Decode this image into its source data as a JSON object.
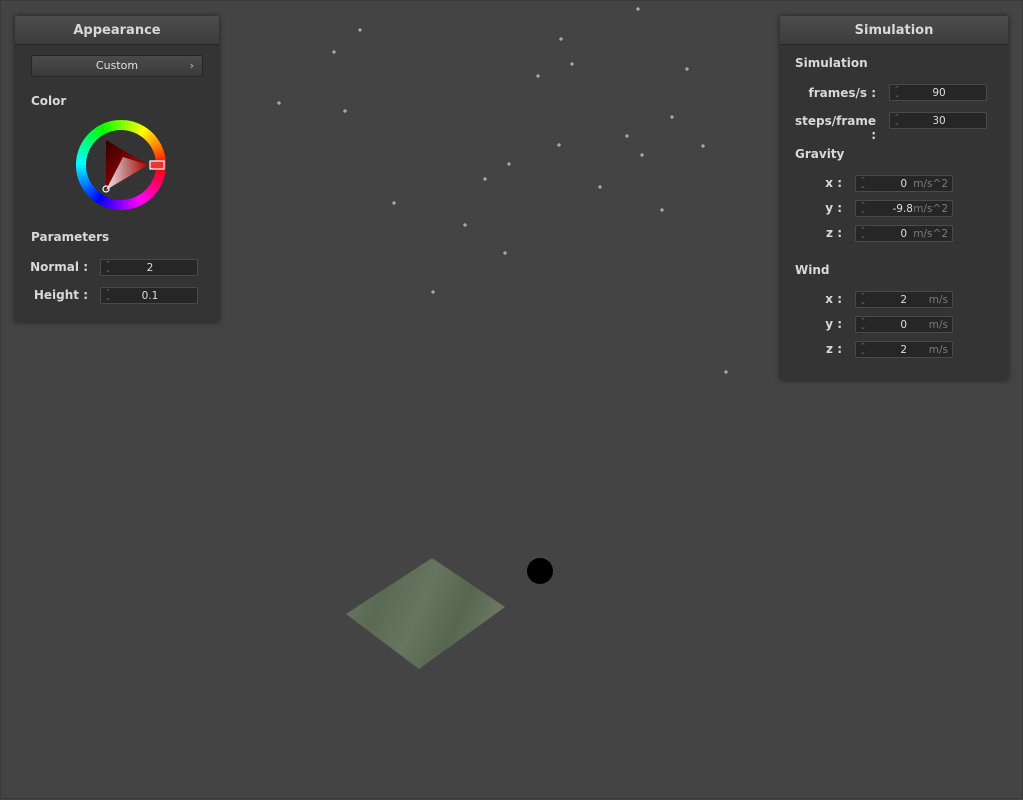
{
  "appearance": {
    "title": "Appearance",
    "preset_button": "Custom",
    "color_label": "Color",
    "selected_color": "#ff0000",
    "parameters_label": "Parameters",
    "normal": {
      "label": "Normal :",
      "value": "2"
    },
    "height": {
      "label": "Height :",
      "value": "0.1"
    }
  },
  "simulation": {
    "title": "Simulation",
    "simulation_section": "Simulation",
    "frames": {
      "label": "frames/s :",
      "value": "90"
    },
    "steps": {
      "label": "steps/frame :",
      "value": "30"
    },
    "gravity_section": "Gravity",
    "gravity": [
      {
        "label": "x :",
        "value": "0",
        "unit": "m/s^2"
      },
      {
        "label": "y :",
        "value": "-9.8",
        "unit": "m/s^2"
      },
      {
        "label": "z :",
        "value": "0",
        "unit": "m/s^2"
      }
    ],
    "wind_section": "Wind",
    "wind": [
      {
        "label": "x :",
        "value": "2",
        "unit": "m/s"
      },
      {
        "label": "y :",
        "value": "0",
        "unit": "m/s"
      },
      {
        "label": "z :",
        "value": "2",
        "unit": "m/s"
      }
    ]
  },
  "scene": {
    "background": "#444444",
    "particle_color": "#a8a8a8",
    "sphere_color": "#000000",
    "cloth_color": "#5f6e58"
  }
}
